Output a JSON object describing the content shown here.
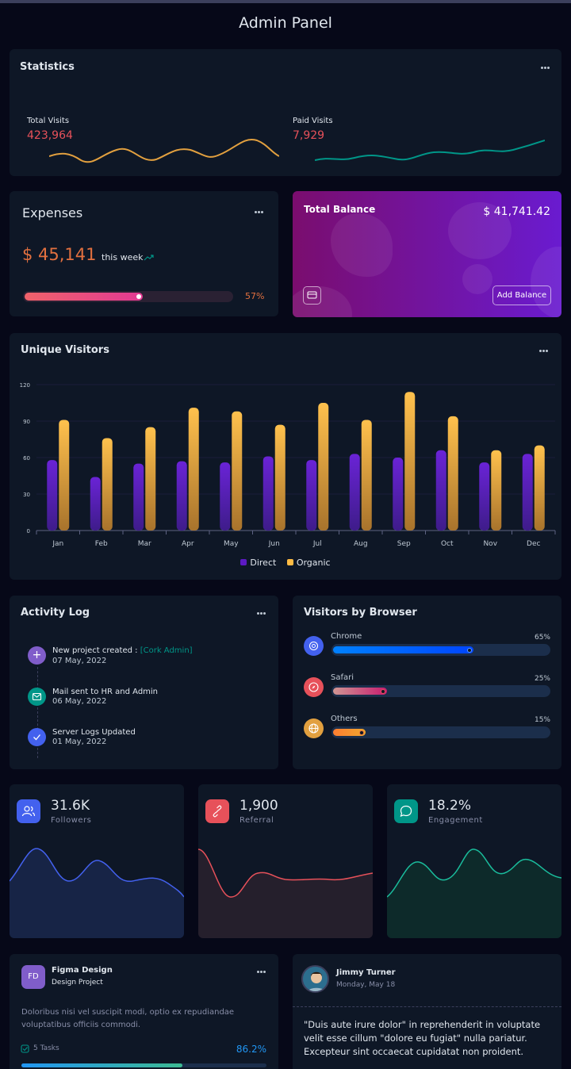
{
  "header": {
    "title": "Admin Panel"
  },
  "statistics": {
    "title": "Statistics",
    "total_visits_label": "Total Visits",
    "total_visits_value": "423,964",
    "paid_visits_label": "Paid Visits",
    "paid_visits_value": "7,929"
  },
  "expenses": {
    "title": "Expenses",
    "amount": "$ 45,141",
    "period": "this week",
    "progress": 0.57,
    "percent_label": "57%"
  },
  "balance": {
    "title": "Total Balance",
    "amount": "$ 41,741.42",
    "button_label": "Add Balance"
  },
  "chart_data": {
    "type": "bar",
    "title": "Unique Visitors",
    "categories": [
      "Jan",
      "Feb",
      "Mar",
      "Apr",
      "May",
      "Jun",
      "Jul",
      "Aug",
      "Sep",
      "Oct",
      "Nov",
      "Dec"
    ],
    "series": [
      {
        "name": "Direct",
        "values": [
          58,
          44,
          55,
          57,
          56,
          61,
          58,
          63,
          60,
          66,
          56,
          63
        ],
        "color": "#5c1ac3"
      },
      {
        "name": "Organic",
        "values": [
          91,
          76,
          85,
          101,
          98,
          87,
          105,
          91,
          114,
          94,
          66,
          70
        ],
        "color": "#ffbb44"
      }
    ],
    "ylim": [
      0,
      120
    ],
    "yticks": [
      "0",
      "30",
      "60",
      "90",
      "120"
    ],
    "legend_position": "bottom"
  },
  "activity": {
    "title": "Activity Log",
    "items": [
      {
        "text": "New project created : ",
        "link": "[Cork Admin]",
        "date": "07 May, 2022",
        "color": "#805dca",
        "icon": "plus-icon"
      },
      {
        "text": "Mail sent to HR and Admin",
        "link": "",
        "date": "06 May, 2022",
        "color": "#009688",
        "icon": "mail-icon"
      },
      {
        "text": "Server Logs Updated",
        "link": "",
        "date": "01 May, 2022",
        "color": "#4361ee",
        "icon": "check-icon"
      }
    ]
  },
  "browsers": {
    "title": "Visitors by Browser",
    "items": [
      {
        "name": "Chrome",
        "percent": "65%",
        "value": 0.65,
        "icon": "chrome-icon"
      },
      {
        "name": "Safari",
        "percent": "25%",
        "value": 0.25,
        "icon": "compass-icon"
      },
      {
        "name": "Others",
        "percent": "15%",
        "value": 0.15,
        "icon": "globe-icon"
      }
    ]
  },
  "cards": [
    {
      "value": "31.6K",
      "label": "Followers",
      "color": "#4361ee",
      "icon": "users-icon"
    },
    {
      "value": "1,900",
      "label": "Referral",
      "color": "#e7515a",
      "icon": "link-icon"
    },
    {
      "value": "18.2%",
      "label": "Engagement",
      "color": "#009688",
      "icon": "message-icon"
    }
  ],
  "project": {
    "initials": "FD",
    "title": "Figma Design",
    "subtitle": "Design Project",
    "description": "Doloribus nisi vel suscipit modi, optio ex repudiandae voluptatibus officiis commodi.",
    "tasks": "5 Tasks",
    "percent": "86.2%"
  },
  "testimonial": {
    "name": "Jimmy Turner",
    "date": "Monday, May 18",
    "quote": "\"Duis aute irure dolor\" in reprehenderit in voluptate velit esse cillum \"dolore eu fugiat\" nulla pariatur. Excepteur sint occaecat cupidatat non proident."
  }
}
